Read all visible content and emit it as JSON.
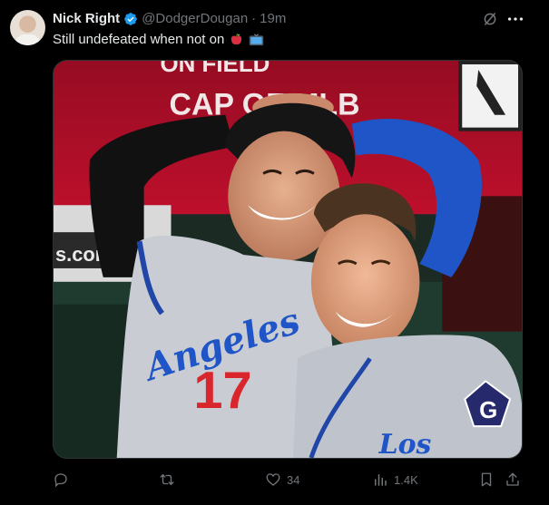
{
  "post": {
    "author_name": "Nick Right",
    "handle": "@DodgerDougan",
    "separator": "·",
    "time": "19m",
    "text": "Still undefeated when not on",
    "emoji": [
      "red-apple",
      "television"
    ]
  },
  "photo": {
    "wall_text_top": "ON FIELD",
    "wall_text_cap": "CAP OF MLB",
    "banner_text": "s.com",
    "jersey_script": "Angeles",
    "jersey_number": "17",
    "patch_letter": "G",
    "jersey_script_right": "Los"
  },
  "actions": {
    "reply_count": "",
    "retweet_count": "",
    "like_count": "34",
    "view_count": "1.4K"
  },
  "colors": {
    "background": "#000000",
    "muted": "#71767b",
    "text": "#e7e9ea",
    "verified": "#1d9bf0",
    "dodger_blue": "#1f55c6",
    "jersey_red": "#d9262c"
  }
}
